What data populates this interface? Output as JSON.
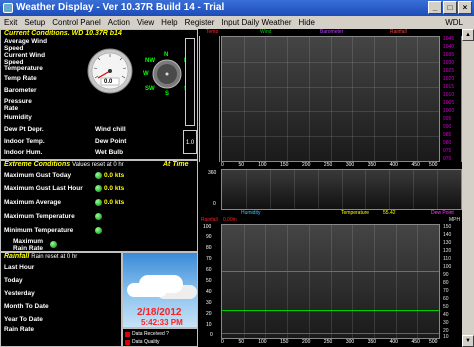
{
  "window": {
    "title": "Weather Display - Ver 10.37R Build 14 - Trial"
  },
  "menu": [
    "Exit",
    "Setup",
    "Control Panel",
    "Action",
    "View",
    "Help",
    "Register",
    "Input Daily Weather",
    "Hide",
    "WDL"
  ],
  "current": {
    "title": "Current Conditions. WD 10.37R b14",
    "labels": [
      "Average Wind Speed",
      "Current Wind Speed",
      "Temperature",
      "Temp Rate",
      "Barometer",
      "Pressure Rate",
      "Humidity",
      "Dew Pt Depr.",
      "Indoor Temp.",
      "Indoor Hum."
    ],
    "right_labels": [
      "Wind chill",
      "Dew Point",
      "Wet Bulb"
    ],
    "gauge_value": "0.0",
    "compass": [
      "N",
      "NE",
      "E",
      "SE",
      "S",
      "SW",
      "W",
      "NW"
    ],
    "uv_box": "1.0"
  },
  "extremes": {
    "title": "Extreme Conditions",
    "subtitle": "Values reset at 0 hr",
    "at_time": "At Time",
    "rows": [
      {
        "label": "Maximum Gust Today",
        "value": "0.0 kts"
      },
      {
        "label": "Maximum Gust Last Hour",
        "value": "0.0 kts"
      },
      {
        "label": "Maximum Average",
        "value": "0.0 kts"
      },
      {
        "label": "Maximum Temperature",
        "value": ""
      },
      {
        "label": "Minimum Temperature",
        "value": ""
      },
      {
        "label": "Maximum Rain Rate",
        "value": ""
      }
    ]
  },
  "rainfall": {
    "title": "Rainfall",
    "subtitle": "Rain reset at 0 hr",
    "rows": [
      "Last Hour",
      "Today",
      "Yesterday",
      "Month To Date",
      "Year To Date",
      "Rain Rate"
    ]
  },
  "clock": {
    "date": "2/18/2012",
    "time": "5:42:33 PM"
  },
  "status": {
    "data_received": "Data Received ?",
    "data_quality": "Data Quality"
  },
  "graph_top": {
    "legend": [
      "Temp",
      "Wind",
      "Barometer",
      "Rainfall"
    ],
    "legend_colors": [
      "#ff2020",
      "#00d000",
      "#c040ff",
      "#ff4040"
    ],
    "y_right": [
      "1045",
      "1040",
      "1035",
      "1030",
      "1025",
      "1020",
      "1015",
      "1010",
      "1005",
      "1000",
      "995",
      "990",
      "985",
      "980",
      "975",
      "970"
    ],
    "x_ticks": [
      "0",
      "50",
      "100",
      "150",
      "200",
      "250",
      "300",
      "350",
      "400",
      "450",
      "500"
    ]
  },
  "graph_mid": {
    "y_left": [
      "360",
      "0"
    ],
    "legend": [
      "Humidity",
      "Temperature",
      "55.42",
      "Dew Point"
    ],
    "legend_colors": [
      "#40c0ff",
      "#ffff00",
      "#ffff00",
      "#ff40ff"
    ]
  },
  "graph_bottom": {
    "header_left": [
      "Rainfall",
      "0.00in"
    ],
    "header_colors": [
      "#ff2020",
      "#ff2020"
    ],
    "y_left": [
      "100",
      "90",
      "80",
      "70",
      "60",
      "50",
      "40",
      "30",
      "20",
      "10",
      "0"
    ],
    "y_right": [
      "150",
      "140",
      "130",
      "120",
      "110",
      "100",
      "90",
      "80",
      "70",
      "60",
      "50",
      "40",
      "30",
      "20",
      "10"
    ],
    "x_ticks": [
      "0",
      "50",
      "100",
      "150",
      "200",
      "250",
      "300",
      "350",
      "400",
      "450",
      "500"
    ],
    "right_label": "MPH"
  }
}
